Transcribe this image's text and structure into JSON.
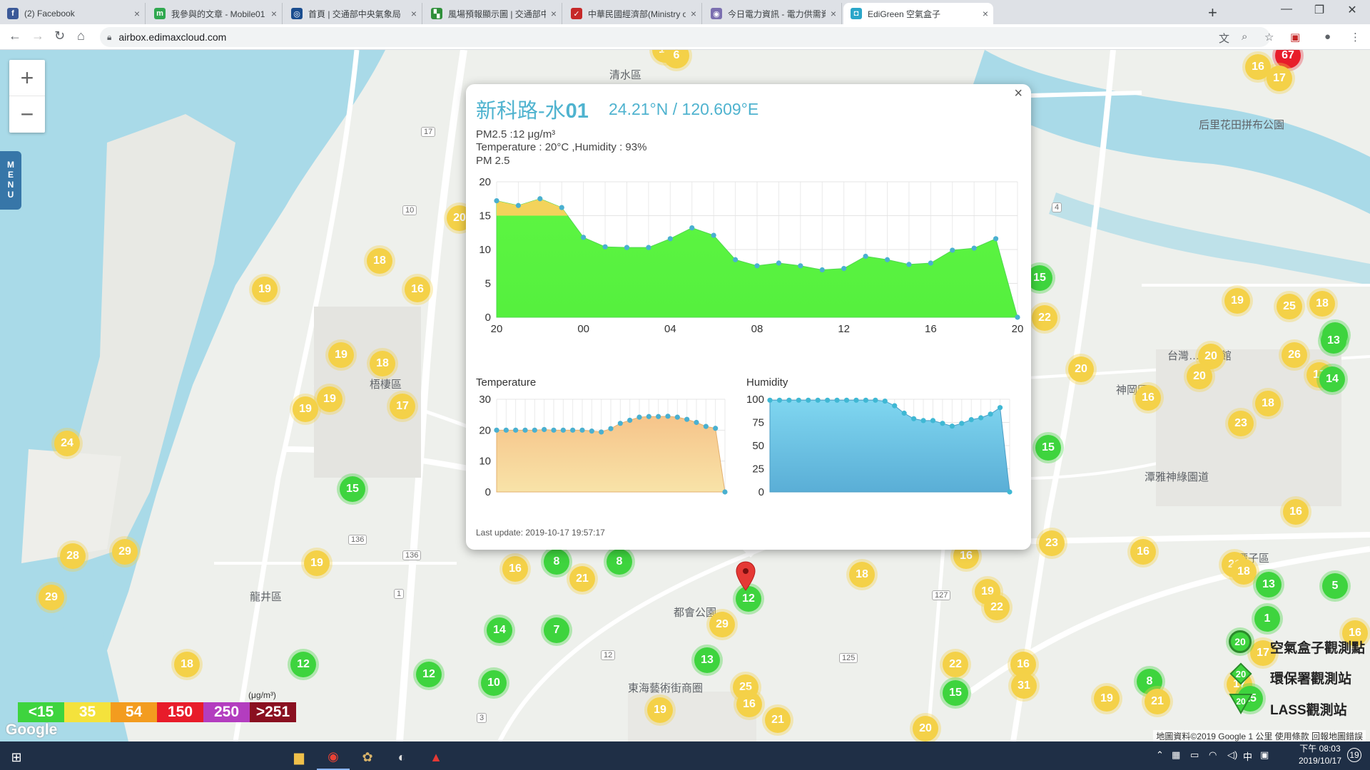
{
  "browser": {
    "tabs": [
      {
        "title": "(2) Facebook",
        "icon": "facebook-icon",
        "color": "#3b5998",
        "glyph": "f"
      },
      {
        "title": "我參與的文章 - Mobile01",
        "icon": "mobile01-icon",
        "color": "#2fa84f",
        "glyph": "m"
      },
      {
        "title": "首頁 | 交通部中央氣象局",
        "icon": "cwb-icon",
        "color": "#1a4d8f",
        "glyph": "◎"
      },
      {
        "title": "風場預報顯示圖 | 交通部中央氣象",
        "icon": "cwb-wind-icon",
        "color": "#2f8f3a",
        "glyph": "▚"
      },
      {
        "title": "中華民國經濟部(Ministry of Eco",
        "icon": "moea-icon",
        "color": "#c62828",
        "glyph": "✓"
      },
      {
        "title": "今日電力資訊 - 電力供需資訊 - 台",
        "icon": "taipower-icon",
        "color": "#7b6fb0",
        "glyph": "◉"
      },
      {
        "title": "EdiGreen 空氣盒子",
        "icon": "edigreen-icon",
        "color": "#2aa6c9",
        "glyph": "◘"
      }
    ],
    "url": "airbox.edimaxcloud.com"
  },
  "map": {
    "place_labels": [
      "清水區",
      "梧棲區",
      "龍井區",
      "都會公園",
      "東海藝術街商圈",
      "神岡區",
      "潭雅神綠園道",
      "后里花田拼布公園",
      "台灣…博物館",
      "潭子區"
    ],
    "road_numbers": [
      "17",
      "10",
      "136",
      "136",
      "125",
      "127",
      "12",
      "1",
      "3",
      "4"
    ],
    "markers": [
      {
        "v": "67",
        "c": "red"
      },
      {
        "v": "16",
        "c": "yellow"
      },
      {
        "v": "17",
        "c": "yellow"
      },
      {
        "v": "16",
        "c": "yellow"
      },
      {
        "v": "6",
        "c": "yellow"
      },
      {
        "v": "18",
        "c": "yellow"
      },
      {
        "v": "19",
        "c": "yellow"
      },
      {
        "v": "16",
        "c": "yellow"
      },
      {
        "v": "20",
        "c": "yellow"
      },
      {
        "v": "19",
        "c": "yellow"
      },
      {
        "v": "18",
        "c": "yellow"
      },
      {
        "v": "19",
        "c": "yellow"
      },
      {
        "v": "19",
        "c": "yellow"
      },
      {
        "v": "17",
        "c": "yellow"
      },
      {
        "v": "24",
        "c": "yellow"
      },
      {
        "v": "15",
        "c": "green"
      },
      {
        "v": "28",
        "c": "yellow"
      },
      {
        "v": "29",
        "c": "yellow"
      },
      {
        "v": "19",
        "c": "yellow"
      },
      {
        "v": "29",
        "c": "yellow"
      },
      {
        "v": "16",
        "c": "yellow"
      },
      {
        "v": "8",
        "c": "green"
      },
      {
        "v": "21",
        "c": "yellow"
      },
      {
        "v": "8",
        "c": "green"
      },
      {
        "v": "14",
        "c": "green"
      },
      {
        "v": "7",
        "c": "green"
      },
      {
        "v": "10",
        "c": "green"
      },
      {
        "v": "12",
        "c": "green"
      },
      {
        "v": "12",
        "c": "green"
      },
      {
        "v": "18",
        "c": "yellow"
      },
      {
        "v": "12",
        "c": "green"
      },
      {
        "v": "29",
        "c": "yellow"
      },
      {
        "v": "13",
        "c": "green"
      },
      {
        "v": "25",
        "c": "yellow"
      },
      {
        "v": "16",
        "c": "yellow"
      },
      {
        "v": "19",
        "c": "yellow"
      },
      {
        "v": "21",
        "c": "yellow"
      },
      {
        "v": "18",
        "c": "yellow"
      },
      {
        "v": "16",
        "c": "yellow"
      },
      {
        "v": "19",
        "c": "yellow"
      },
      {
        "v": "22",
        "c": "yellow"
      },
      {
        "v": "23",
        "c": "yellow"
      },
      {
        "v": "16",
        "c": "yellow"
      },
      {
        "v": "22",
        "c": "yellow"
      },
      {
        "v": "15",
        "c": "green"
      },
      {
        "v": "16",
        "c": "yellow"
      },
      {
        "v": "31",
        "c": "yellow"
      },
      {
        "v": "20",
        "c": "yellow"
      },
      {
        "v": "15",
        "c": "green"
      },
      {
        "v": "22",
        "c": "yellow"
      },
      {
        "v": "15",
        "c": "green"
      },
      {
        "v": "20",
        "c": "yellow"
      },
      {
        "v": "16",
        "c": "yellow"
      },
      {
        "v": "19",
        "c": "yellow"
      },
      {
        "v": "25",
        "c": "yellow"
      },
      {
        "v": "18",
        "c": "yellow"
      },
      {
        "v": "13",
        "c": "green"
      },
      {
        "v": "20",
        "c": "yellow"
      },
      {
        "v": "26",
        "c": "yellow"
      },
      {
        "v": "20",
        "c": "yellow"
      },
      {
        "v": "13",
        "c": "green"
      },
      {
        "v": "17",
        "c": "yellow"
      },
      {
        "v": "14",
        "c": "green"
      },
      {
        "v": "18",
        "c": "yellow"
      },
      {
        "v": "23",
        "c": "yellow"
      },
      {
        "v": "16",
        "c": "yellow"
      },
      {
        "v": "21",
        "c": "yellow"
      },
      {
        "v": "18",
        "c": "yellow"
      },
      {
        "v": "13",
        "c": "green"
      },
      {
        "v": "5",
        "c": "green"
      },
      {
        "v": "1",
        "c": "green"
      },
      {
        "v": "17",
        "c": "yellow"
      },
      {
        "v": "16",
        "c": "yellow"
      },
      {
        "v": "8",
        "c": "green"
      },
      {
        "v": "19",
        "c": "yellow"
      },
      {
        "v": "21",
        "c": "yellow"
      },
      {
        "v": "17",
        "c": "yellow"
      },
      {
        "v": "15",
        "c": "green"
      }
    ],
    "legend": [
      {
        "label": "<15",
        "color": "#3ed43e"
      },
      {
        "label": "35",
        "color": "#f4e23c"
      },
      {
        "label": "54",
        "color": "#f39c1f"
      },
      {
        "label": "150",
        "color": "#e81c2a"
      },
      {
        "label": "250",
        "color": "#b33dbf"
      },
      {
        "label": ">251",
        "color": "#8a1020"
      }
    ],
    "legend_unit": "(μg/m³)",
    "station_legend": [
      {
        "label": "空氣盒子觀測點",
        "value": "20"
      },
      {
        "label": "環保署觀測站",
        "value": "20"
      },
      {
        "label": "LASS觀測站",
        "value": "20"
      }
    ],
    "attribution": "地圖資料©2019 Google    1 公里           使用條款    回報地圖錯誤",
    "google": "Google"
  },
  "popup": {
    "site_prefix": "新科路-水",
    "site_suffix": "01",
    "coords": "24.21°N / 120.609°E",
    "pm25_line": "PM2.5 :12 μg/m³",
    "temp_humidity_line": "Temperature : 20°C ,Humidity : 93%",
    "pm_title": "PM 2.5",
    "temperature_title": "Temperature",
    "humidity_title": "Humidity",
    "last_update": "Last update: 2019-10-17 19:57:17"
  },
  "chart_data": [
    {
      "type": "area",
      "title": "PM 2.5",
      "x_ticks": [
        "20",
        "00",
        "04",
        "08",
        "12",
        "16",
        "20"
      ],
      "ylim": [
        0,
        20
      ],
      "y_ticks": [
        0,
        5,
        10,
        15,
        20
      ],
      "values": [
        17.2,
        16.5,
        17.5,
        16.2,
        11.8,
        10.4,
        10.3,
        10.3,
        11.6,
        13.2,
        12.1,
        8.5,
        7.6,
        8.0,
        7.6,
        7.0,
        7.2,
        9.0,
        8.5,
        7.8,
        8.0,
        9.9,
        10.2,
        11.6,
        0
      ]
    },
    {
      "type": "area",
      "title": "Temperature",
      "ylim": [
        0,
        30
      ],
      "y_ticks": [
        0,
        10,
        20,
        30
      ],
      "values": [
        20,
        20,
        20,
        20,
        20,
        20.2,
        20,
        20,
        20,
        20,
        19.7,
        19.4,
        20.5,
        22.2,
        23.2,
        24.2,
        24.4,
        24.4,
        24.5,
        24.2,
        23.5,
        22.5,
        21.2,
        20.6,
        0
      ]
    },
    {
      "type": "area",
      "title": "Humidity",
      "ylim": [
        0,
        100
      ],
      "y_ticks": [
        0,
        25,
        50,
        75,
        100
      ],
      "values": [
        99,
        99,
        99,
        99,
        99,
        99,
        99,
        99,
        99,
        99,
        99,
        99,
        98,
        93,
        85,
        79,
        77,
        77,
        74,
        71,
        74,
        78,
        80,
        84,
        91,
        0
      ]
    }
  ],
  "taskbar": {
    "time": "下午 08:03",
    "date": "2019/10/17",
    "ime": "中",
    "notify_count": "19"
  }
}
